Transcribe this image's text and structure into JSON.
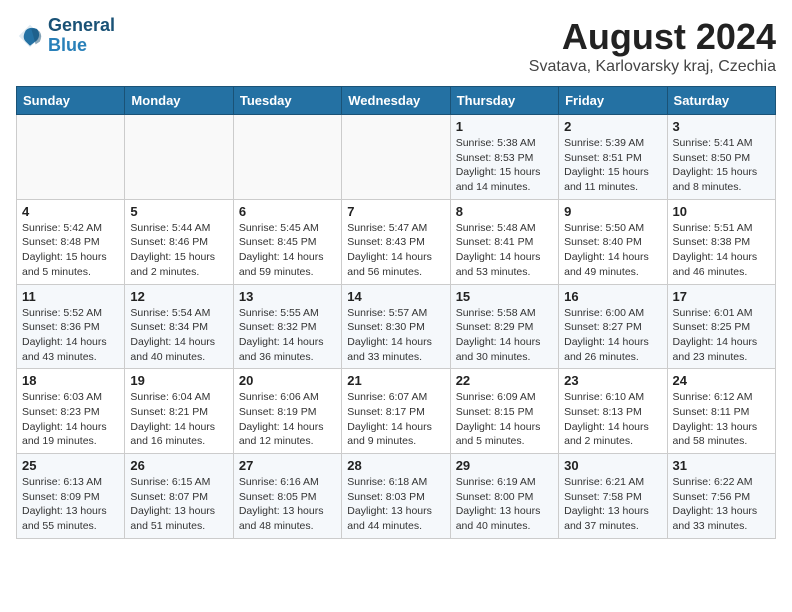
{
  "header": {
    "logo_line1": "General",
    "logo_line2": "Blue",
    "month": "August 2024",
    "location": "Svatava, Karlovarsky kraj, Czechia"
  },
  "weekdays": [
    "Sunday",
    "Monday",
    "Tuesday",
    "Wednesday",
    "Thursday",
    "Friday",
    "Saturday"
  ],
  "weeks": [
    [
      {
        "day": "",
        "info": ""
      },
      {
        "day": "",
        "info": ""
      },
      {
        "day": "",
        "info": ""
      },
      {
        "day": "",
        "info": ""
      },
      {
        "day": "1",
        "info": "Sunrise: 5:38 AM\nSunset: 8:53 PM\nDaylight: 15 hours\nand 14 minutes."
      },
      {
        "day": "2",
        "info": "Sunrise: 5:39 AM\nSunset: 8:51 PM\nDaylight: 15 hours\nand 11 minutes."
      },
      {
        "day": "3",
        "info": "Sunrise: 5:41 AM\nSunset: 8:50 PM\nDaylight: 15 hours\nand 8 minutes."
      }
    ],
    [
      {
        "day": "4",
        "info": "Sunrise: 5:42 AM\nSunset: 8:48 PM\nDaylight: 15 hours\nand 5 minutes."
      },
      {
        "day": "5",
        "info": "Sunrise: 5:44 AM\nSunset: 8:46 PM\nDaylight: 15 hours\nand 2 minutes."
      },
      {
        "day": "6",
        "info": "Sunrise: 5:45 AM\nSunset: 8:45 PM\nDaylight: 14 hours\nand 59 minutes."
      },
      {
        "day": "7",
        "info": "Sunrise: 5:47 AM\nSunset: 8:43 PM\nDaylight: 14 hours\nand 56 minutes."
      },
      {
        "day": "8",
        "info": "Sunrise: 5:48 AM\nSunset: 8:41 PM\nDaylight: 14 hours\nand 53 minutes."
      },
      {
        "day": "9",
        "info": "Sunrise: 5:50 AM\nSunset: 8:40 PM\nDaylight: 14 hours\nand 49 minutes."
      },
      {
        "day": "10",
        "info": "Sunrise: 5:51 AM\nSunset: 8:38 PM\nDaylight: 14 hours\nand 46 minutes."
      }
    ],
    [
      {
        "day": "11",
        "info": "Sunrise: 5:52 AM\nSunset: 8:36 PM\nDaylight: 14 hours\nand 43 minutes."
      },
      {
        "day": "12",
        "info": "Sunrise: 5:54 AM\nSunset: 8:34 PM\nDaylight: 14 hours\nand 40 minutes."
      },
      {
        "day": "13",
        "info": "Sunrise: 5:55 AM\nSunset: 8:32 PM\nDaylight: 14 hours\nand 36 minutes."
      },
      {
        "day": "14",
        "info": "Sunrise: 5:57 AM\nSunset: 8:30 PM\nDaylight: 14 hours\nand 33 minutes."
      },
      {
        "day": "15",
        "info": "Sunrise: 5:58 AM\nSunset: 8:29 PM\nDaylight: 14 hours\nand 30 minutes."
      },
      {
        "day": "16",
        "info": "Sunrise: 6:00 AM\nSunset: 8:27 PM\nDaylight: 14 hours\nand 26 minutes."
      },
      {
        "day": "17",
        "info": "Sunrise: 6:01 AM\nSunset: 8:25 PM\nDaylight: 14 hours\nand 23 minutes."
      }
    ],
    [
      {
        "day": "18",
        "info": "Sunrise: 6:03 AM\nSunset: 8:23 PM\nDaylight: 14 hours\nand 19 minutes."
      },
      {
        "day": "19",
        "info": "Sunrise: 6:04 AM\nSunset: 8:21 PM\nDaylight: 14 hours\nand 16 minutes."
      },
      {
        "day": "20",
        "info": "Sunrise: 6:06 AM\nSunset: 8:19 PM\nDaylight: 14 hours\nand 12 minutes."
      },
      {
        "day": "21",
        "info": "Sunrise: 6:07 AM\nSunset: 8:17 PM\nDaylight: 14 hours\nand 9 minutes."
      },
      {
        "day": "22",
        "info": "Sunrise: 6:09 AM\nSunset: 8:15 PM\nDaylight: 14 hours\nand 5 minutes."
      },
      {
        "day": "23",
        "info": "Sunrise: 6:10 AM\nSunset: 8:13 PM\nDaylight: 14 hours\nand 2 minutes."
      },
      {
        "day": "24",
        "info": "Sunrise: 6:12 AM\nSunset: 8:11 PM\nDaylight: 13 hours\nand 58 minutes."
      }
    ],
    [
      {
        "day": "25",
        "info": "Sunrise: 6:13 AM\nSunset: 8:09 PM\nDaylight: 13 hours\nand 55 minutes."
      },
      {
        "day": "26",
        "info": "Sunrise: 6:15 AM\nSunset: 8:07 PM\nDaylight: 13 hours\nand 51 minutes."
      },
      {
        "day": "27",
        "info": "Sunrise: 6:16 AM\nSunset: 8:05 PM\nDaylight: 13 hours\nand 48 minutes."
      },
      {
        "day": "28",
        "info": "Sunrise: 6:18 AM\nSunset: 8:03 PM\nDaylight: 13 hours\nand 44 minutes."
      },
      {
        "day": "29",
        "info": "Sunrise: 6:19 AM\nSunset: 8:00 PM\nDaylight: 13 hours\nand 40 minutes."
      },
      {
        "day": "30",
        "info": "Sunrise: 6:21 AM\nSunset: 7:58 PM\nDaylight: 13 hours\nand 37 minutes."
      },
      {
        "day": "31",
        "info": "Sunrise: 6:22 AM\nSunset: 7:56 PM\nDaylight: 13 hours\nand 33 minutes."
      }
    ]
  ]
}
